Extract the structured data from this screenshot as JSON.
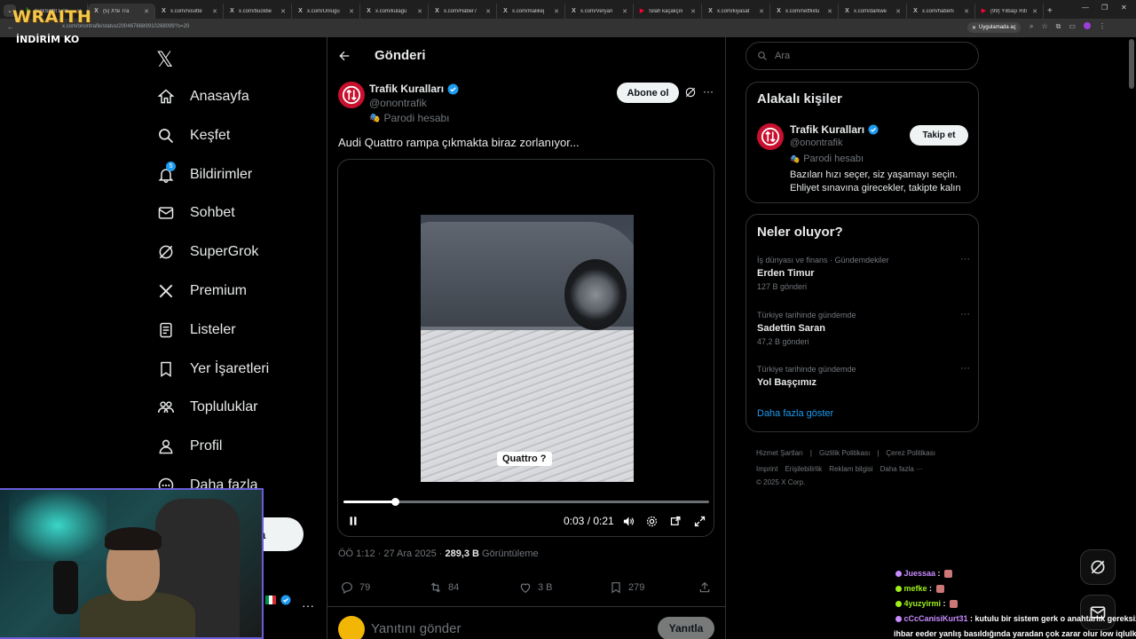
{
  "browser": {
    "tabs": [
      {
        "title": "KickSight Link",
        "fav": "k",
        "color": "#53fc18"
      },
      {
        "title": "(5) X'te Tra",
        "fav": "X",
        "color": "#fff",
        "active": true
      },
      {
        "title": "x.com/nouitte",
        "fav": "X",
        "color": "#fff"
      },
      {
        "title": "x.com/buckbe",
        "fav": "X",
        "color": "#fff"
      },
      {
        "title": "x.com/Unlugu",
        "fav": "X",
        "color": "#fff"
      },
      {
        "title": "x.com/kulagu",
        "fav": "X",
        "color": "#fff"
      },
      {
        "title": "x.com/Haber7",
        "fav": "X",
        "color": "#fff"
      },
      {
        "title": "x.com/malikej",
        "fav": "X",
        "color": "#fff"
      },
      {
        "title": "x.com/Veryan",
        "fav": "X",
        "color": "#fff"
      },
      {
        "title": "Silah kaçakçılı",
        "fav": "▶",
        "color": "#ff0033"
      },
      {
        "title": "x.com/kiyasat",
        "fav": "X",
        "color": "#fff"
      },
      {
        "title": "x.com/netflixtu",
        "fav": "X",
        "color": "#fff"
      },
      {
        "title": "x.com/darkwe",
        "fav": "X",
        "color": "#fff"
      },
      {
        "title": "x.com/haberli",
        "fav": "X",
        "color": "#fff"
      },
      {
        "title": "(99) Yılbaşı Riti",
        "fav": "▶",
        "color": "#ff0033"
      }
    ],
    "url": "x.com/onontrafik/status/2004676689910268099?s=20",
    "app_pill": "Uygulamada aç",
    "overlay_logo": "WRAITH",
    "overlay_sub": "İNDİRİM KO"
  },
  "nav": {
    "items": [
      {
        "label": "Anasayfa",
        "icon": "home-icon"
      },
      {
        "label": "Keşfet",
        "icon": "search-icon"
      },
      {
        "label": "Bildirimler",
        "icon": "bell-icon",
        "badge": "5"
      },
      {
        "label": "Sohbet",
        "icon": "mail-icon"
      },
      {
        "label": "SuperGrok",
        "icon": "grok-icon"
      },
      {
        "label": "Premium",
        "icon": "x-icon"
      },
      {
        "label": "Listeler",
        "icon": "list-icon"
      },
      {
        "label": "Yer İşaretleri",
        "icon": "bookmark-icon"
      },
      {
        "label": "Topluluklar",
        "icon": "communities-icon"
      },
      {
        "label": "Profil",
        "icon": "profile-icon"
      },
      {
        "label": "Daha fazla",
        "icon": "more-circle-icon"
      }
    ],
    "post_button": "a"
  },
  "post": {
    "header": "Gönderi",
    "author_name": "Trafik Kuralları",
    "author_handle": "@onontrafik",
    "parody_label": "Parodi hesabı",
    "follow_label": "Abone ol",
    "text": "Audi Quattro rampa çıkmakta biraz zorlanıyor...",
    "video": {
      "caption": "Quattro ?",
      "time": "0:03 / 0:21",
      "progress": 0.14
    },
    "meta": {
      "time": "ÖÖ 1:12 · 27 Ara 2025 · ",
      "views": "289,3 B",
      "views_label": " Görüntüleme"
    },
    "actions": {
      "replies": "79",
      "reposts": "84",
      "likes": "3 B",
      "bookmarks": "279"
    },
    "reply_placeholder": "Yanıtını gönder",
    "reply_button": "Yanıtla"
  },
  "sidebar": {
    "search_placeholder": "Ara",
    "relevant": {
      "title": "Alakalı kişiler",
      "name": "Trafik Kuralları",
      "handle": "@onontrafik",
      "parody": "Parodi hesabı",
      "bio": "Bazıları hızı seçer, siz yaşamayı seçin. Ehliyet sınavına girecekler, takipte kalın",
      "follow": "Takip et"
    },
    "trends_title": "Neler oluyor?",
    "trends": [
      {
        "context": "İş dünyası ve finans · Gündemdekiler",
        "name": "Erden Timur",
        "count": "127 B gönderi"
      },
      {
        "context": "Türkiye tarihinde gündemde",
        "name": "Sadettin Saran",
        "count": "47,2 B gönderi"
      },
      {
        "context": "Türkiye tarihinde gündemde",
        "name": "Yol Başçımız",
        "count": ""
      }
    ],
    "show_more": "Daha fazla göster",
    "footer": {
      "line1": [
        "Hizmet Şartları",
        "Gizlilik Politikası",
        "Çerez Politikası"
      ],
      "line2": [
        "Imprint",
        "Erişilebilirlik",
        "Reklam bilgisi",
        "Daha fazla ···"
      ],
      "copyright": "© 2025 X Corp."
    }
  },
  "chat": [
    {
      "user": "Juessaa",
      "color": "#c98bff",
      "msg": ""
    },
    {
      "user": "mefke",
      "color": "#9ef01a",
      "msg": ""
    },
    {
      "user": "4yuzyirmi",
      "color": "#9ef01a",
      "msg": ""
    },
    {
      "user": "cCcCanisiKurt31",
      "color": "#c98bff",
      "msg": "kutulu bir sistem gerk o anahtarlık gereksiz"
    },
    {
      "user": "",
      "color": "#fff",
      "msg": "ihbar eeder yanlış basıldığında yaradan çok zarar olur low iqlulk"
    }
  ]
}
